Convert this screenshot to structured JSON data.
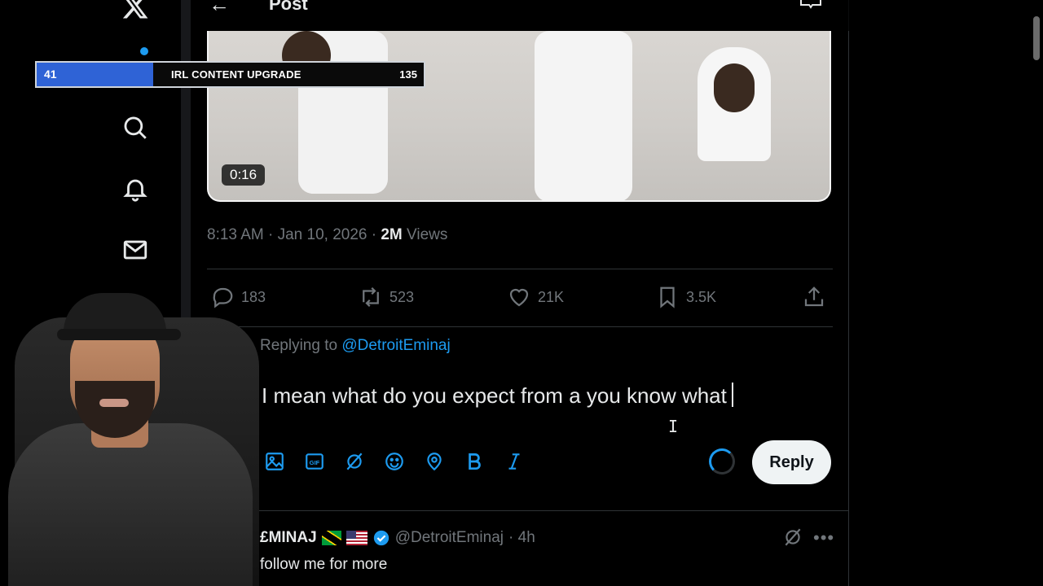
{
  "header": {
    "title": "Post",
    "back_glyph": "←"
  },
  "overlay": {
    "goal_current": "41",
    "goal_title": "IRL CONTENT UPGRADE",
    "goal_target": "135",
    "goal_progress": 0.3
  },
  "post": {
    "video_duration": "0:16",
    "timestamp": "8:13 AM · Jan 10, 2026 · ",
    "views_count": "2M",
    "views_label": " Views",
    "stats": {
      "replies": "183",
      "reposts": "523",
      "likes": "21K",
      "bookmarks": "3.5K"
    }
  },
  "composer": {
    "replying_prefix": "Replying to ",
    "replying_handle": "@DetroitEminaj",
    "text": "I mean what do you expect from a you know what",
    "reply_label": "Reply",
    "tools": [
      "image-icon",
      "gif-icon",
      "grok-icon",
      "emoji-icon",
      "location-icon",
      "bold-icon",
      "italic-icon"
    ]
  },
  "reply": {
    "name": "£MINAJ",
    "handle": "@DetroitEminaj",
    "time": "· 4h",
    "body": "follow me for more"
  },
  "colors": {
    "accent": "#1d9bf0",
    "muted": "#71767b",
    "goal_fill": "#2f63d6"
  }
}
